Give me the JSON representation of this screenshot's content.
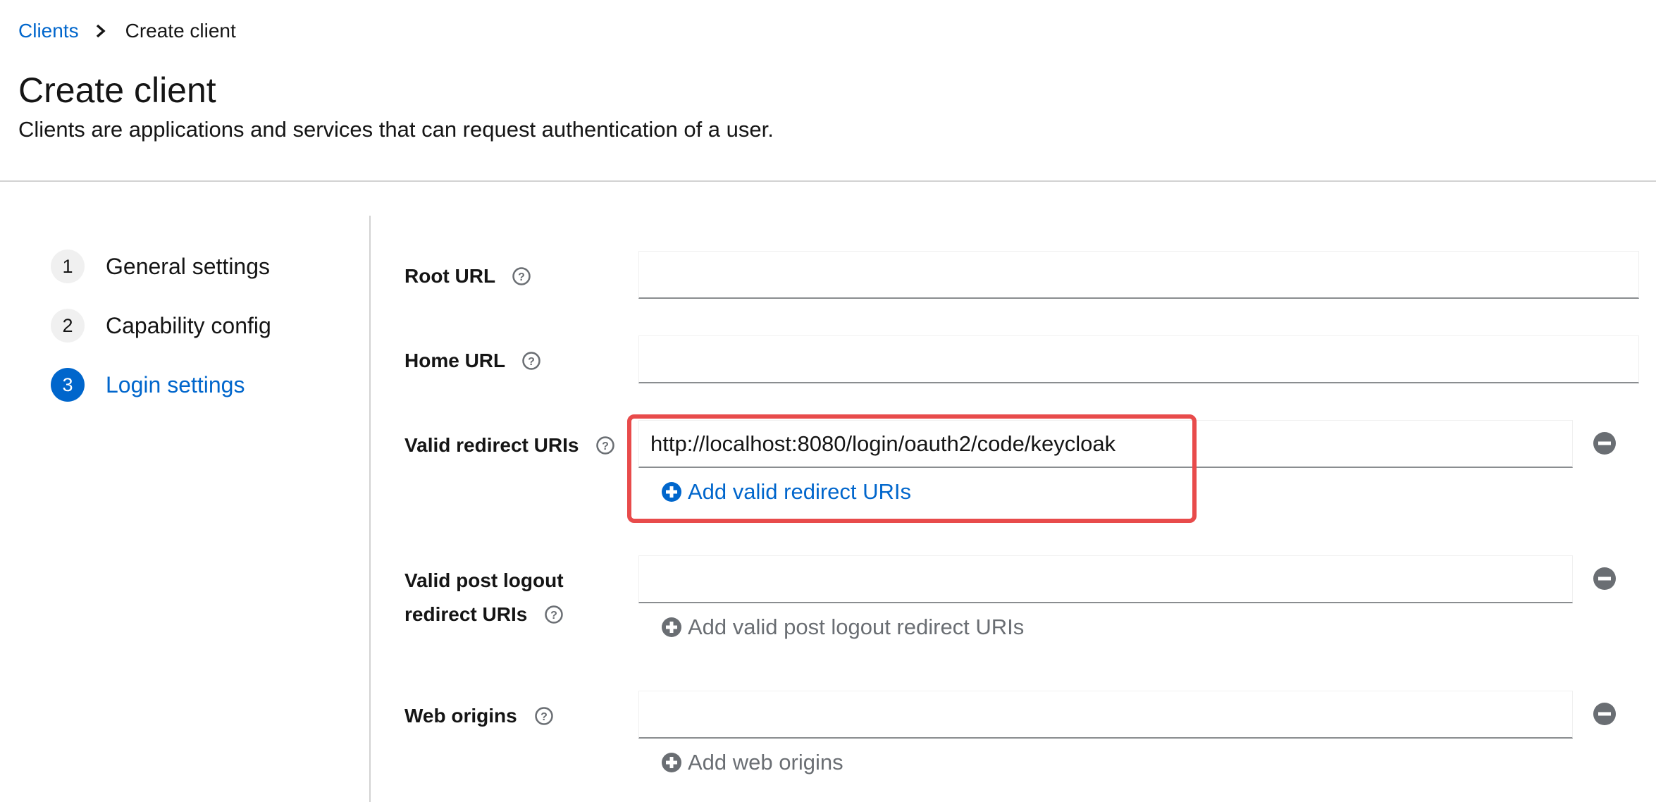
{
  "breadcrumb": {
    "parent": "Clients",
    "current": "Create client"
  },
  "page": {
    "title": "Create client",
    "description": "Clients are applications and services that can request authentication of a user."
  },
  "wizard": {
    "steps": [
      {
        "number": "1",
        "label": "General settings",
        "active": false
      },
      {
        "number": "2",
        "label": "Capability config",
        "active": false
      },
      {
        "number": "3",
        "label": "Login settings",
        "active": true
      }
    ]
  },
  "form": {
    "root_url": {
      "label": "Root URL",
      "value": ""
    },
    "home_url": {
      "label": "Home URL",
      "value": ""
    },
    "valid_redirect": {
      "label": "Valid redirect URIs",
      "value": "http://localhost:8080/login/oauth2/code/keycloak",
      "add_label": "Add valid redirect URIs"
    },
    "post_logout": {
      "label_line1": "Valid post logout",
      "label_line2": "redirect URIs",
      "value": "",
      "add_label": "Add valid post logout redirect URIs"
    },
    "web_origins": {
      "label": "Web origins",
      "value": "",
      "add_label": "Add web origins"
    }
  },
  "colors": {
    "link": "#0066cc",
    "highlight": "#e84b4b",
    "disabled": "#6a6e73"
  }
}
